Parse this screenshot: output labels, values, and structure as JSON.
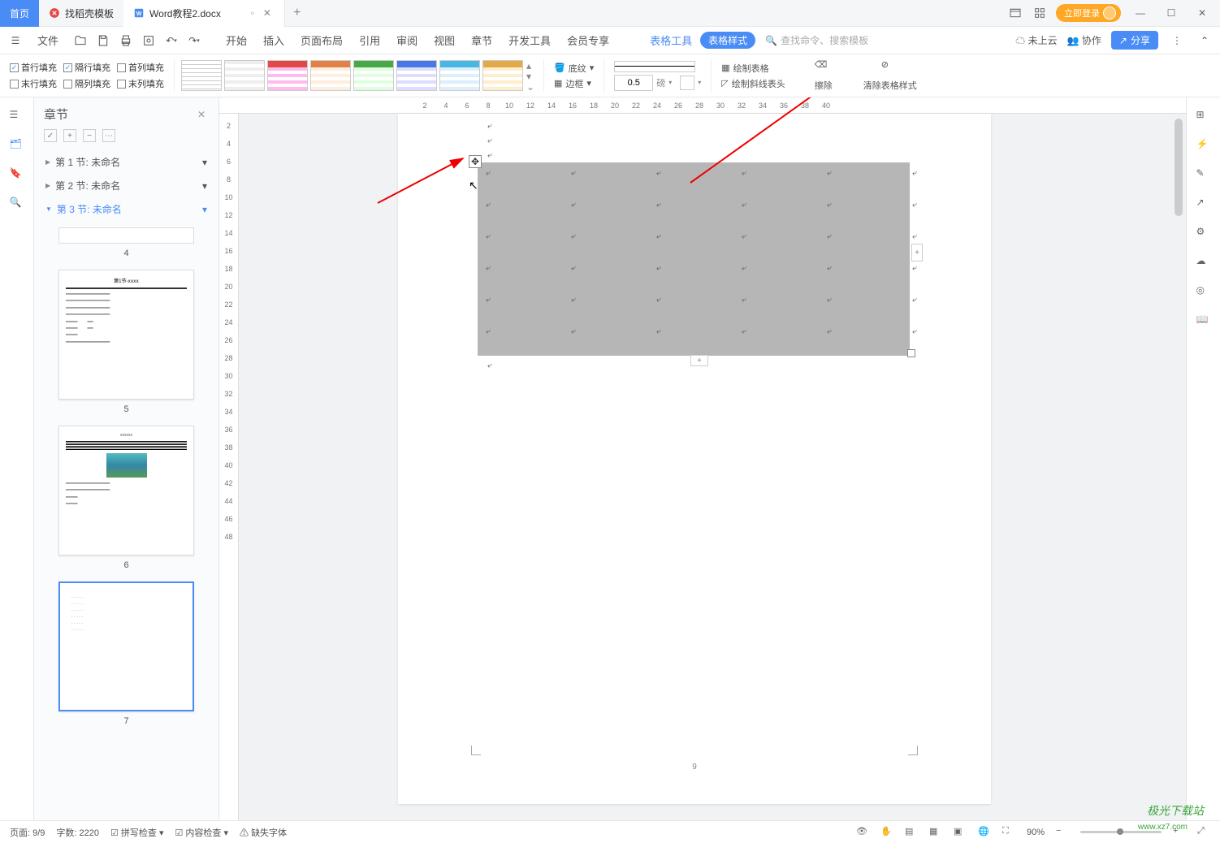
{
  "titlebar": {
    "home_tab": "首页",
    "template_tab": "找稻壳模板",
    "doc_tab": "Word教程2.docx",
    "login": "立即登录"
  },
  "menubar": {
    "file": "文件",
    "start": "开始",
    "insert": "插入",
    "page_layout": "页面布局",
    "reference": "引用",
    "review": "审阅",
    "view": "视图",
    "chapter": "章节",
    "dev_tools": "开发工具",
    "vip": "会员专享",
    "table_tools": "表格工具",
    "table_style": "表格样式",
    "search_placeholder": "查找命令、搜索模板",
    "not_cloud": "未上云",
    "collab": "协作",
    "share": "分享"
  },
  "ribbon": {
    "first_row_fill": "首行填充",
    "alt_row_fill": "隔行填充",
    "first_col_fill": "首列填充",
    "last_row_fill": "末行填充",
    "alt_col_fill": "隔列填充",
    "last_col_fill": "末列填充",
    "shading": "底纹",
    "border": "边框",
    "border_width": "0.5",
    "border_unit": "磅",
    "draw_table": "绘制表格",
    "draw_diagonal": "绘制斜线表头",
    "eraser": "擦除",
    "clear_style": "清除表格样式"
  },
  "chapter_panel": {
    "title": "章节",
    "section1": "第 1 节: 未命名",
    "section2": "第 2 节: 未命名",
    "section3": "第 3 节: 未命名",
    "thumb4": "4",
    "thumb5": "5",
    "thumb6": "6",
    "thumb7": "7"
  },
  "hruler_ticks": [
    "2",
    "4",
    "6",
    "8",
    "10",
    "12",
    "14",
    "16",
    "18",
    "20",
    "22",
    "24",
    "26",
    "28",
    "30",
    "32",
    "34",
    "36",
    "38",
    "40"
  ],
  "vruler_ticks": [
    "2",
    "4",
    "6",
    "8",
    "10",
    "12",
    "14",
    "16",
    "18",
    "20",
    "22",
    "24",
    "26",
    "28",
    "30",
    "32",
    "34",
    "36",
    "38",
    "40",
    "42",
    "44",
    "46",
    "48"
  ],
  "page": {
    "number": "9"
  },
  "statusbar": {
    "page": "页面: 9/9",
    "words": "字数: 2220",
    "spell": "拼写检查",
    "content": "内容检查",
    "missing_font": "缺失字体",
    "zoom": "90%"
  },
  "watermark": {
    "text1": "极光下载站",
    "text2": "www.xz7.com"
  }
}
